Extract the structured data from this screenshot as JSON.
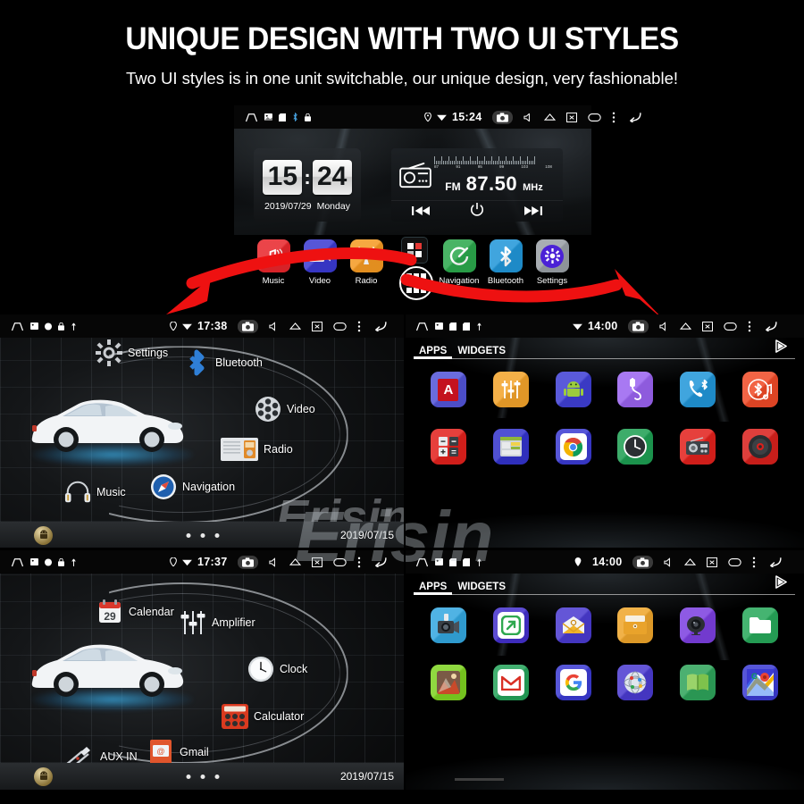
{
  "header": {
    "title": "UNIQUE DESIGN WITH TWO UI STYLES",
    "subtitle": "Two UI styles is in one unit switchable, our unique design, very fashionable!"
  },
  "brand": {
    "watermark": "Erisin",
    "accent": "#ff0000"
  },
  "statusbar_icons": {
    "home": "home-icon",
    "image": "image-icon",
    "sd": "sd-card-icon",
    "lock": "lock-icon",
    "usb": "usb-icon",
    "gps": "gps-icon",
    "wifi": "wifi-icon",
    "camera": "camera-icon",
    "mute": "volume-mute-icon",
    "eject": "eject-icon",
    "close": "close-window-icon",
    "recents": "recents-icon",
    "menu": "overflow-menu-icon",
    "back": "back-icon"
  },
  "home_screen": {
    "statusbar": {
      "time": "15:24"
    },
    "clock_widget": {
      "hours": "15",
      "colon": ":",
      "minutes": "24",
      "date": "2019/07/29",
      "weekday": "Monday"
    },
    "radio_widget": {
      "band": "FM",
      "frequency": "87.50",
      "unit": "MHz",
      "scale_labels": [
        "87",
        "91",
        "95",
        "99",
        "103",
        "108"
      ],
      "prev_label": "prev-track-icon",
      "power_label": "power-icon",
      "next_label": "next-track-icon"
    },
    "dock": [
      {
        "label": "Music",
        "icon": "music-icon",
        "color": "#e8262b"
      },
      {
        "label": "Video",
        "icon": "video-icon",
        "color": "#3b3ad2"
      },
      {
        "label": "Radio",
        "icon": "radio-tower-icon",
        "color": "#f59a22"
      },
      {
        "label": "Navigation",
        "icon": "navigation-icon",
        "color": "#2ba84c"
      },
      {
        "label": "Bluetooth",
        "icon": "bluetooth-icon",
        "color": "#2196d8"
      },
      {
        "label": "Settings",
        "icon": "settings-gear-icon",
        "color": "#9aa0a6"
      }
    ],
    "grid_buttons": {
      "small": "apps-grid-small-icon",
      "large": "apps-grid-large-icon"
    }
  },
  "carousel_top": {
    "statusbar": {
      "time": "17:38"
    },
    "items": [
      {
        "label": "Settings",
        "icon": "settings-gear-icon"
      },
      {
        "label": "Bluetooth",
        "icon": "bluetooth-icon"
      },
      {
        "label": "Video",
        "icon": "film-reel-icon"
      },
      {
        "label": "Radio",
        "icon": "radio-set-icon"
      },
      {
        "label": "Navigation",
        "icon": "compass-icon"
      },
      {
        "label": "Music",
        "icon": "headphones-icon"
      }
    ],
    "bottom_bar": {
      "date": "2019/07/15",
      "page_dots": 3,
      "active_dot": 0,
      "android_icon": "android-icon"
    }
  },
  "carousel_bottom": {
    "statusbar": {
      "time": "17:37"
    },
    "items": [
      {
        "label": "Calendar",
        "icon": "calendar-icon"
      },
      {
        "label": "Amplifier",
        "icon": "equalizer-icon"
      },
      {
        "label": "Clock",
        "icon": "analog-clock-icon"
      },
      {
        "label": "Calculator",
        "icon": "calculator-icon"
      },
      {
        "label": "Gmail",
        "icon": "gmail-icon"
      },
      {
        "label": "AUX IN",
        "icon": "aux-plug-icon"
      }
    ],
    "bottom_bar": {
      "date": "2019/07/15",
      "page_dots": 3,
      "active_dot": 0,
      "android_icon": "android-icon"
    }
  },
  "apps_drawer_top": {
    "statusbar": {
      "time": "14:00"
    },
    "tabs": [
      {
        "label": "APPS",
        "active": true
      },
      {
        "label": "WIDGETS",
        "active": false
      }
    ],
    "play_store_icon": "play-store-icon",
    "apps": [
      {
        "label": "Adobe Acrob",
        "icon": "adobe-acrobat-icon",
        "color": "#5254d8"
      },
      {
        "label": "Amplifier",
        "icon": "equalizer-icon",
        "color": "#f3a32a"
      },
      {
        "label": "APK Installer",
        "icon": "apk-installer-icon",
        "color": "#3f3fd4"
      },
      {
        "label": "AUX IN",
        "icon": "aux-plug-icon",
        "color": "#9a63f0"
      },
      {
        "label": "Bluetooth",
        "icon": "bluetooth-phone-icon",
        "color": "#2196d8"
      },
      {
        "label": "BT Music",
        "icon": "bt-music-icon",
        "color": "#f04a27"
      },
      {
        "label": "Calculator",
        "icon": "calculator-icon",
        "color": "#e2211c"
      },
      {
        "label": "Calendar",
        "icon": "calendar-icon",
        "color": "#3333cc"
      },
      {
        "label": "Chrome",
        "icon": "chrome-icon",
        "color": "#3b3ad2"
      },
      {
        "label": "Clock",
        "icon": "clock-icon",
        "color": "#1d9e52"
      },
      {
        "label": "DAB+",
        "icon": "dab-radio-icon",
        "color": "#e2211c"
      },
      {
        "label": "DVD",
        "icon": "dvd-disc-icon",
        "color": "#d8201c"
      }
    ]
  },
  "apps_drawer_bottom": {
    "statusbar": {
      "time": "14:00"
    },
    "tabs": [
      {
        "label": "APPS",
        "active": true
      },
      {
        "label": "WIDGETS",
        "active": false
      }
    ],
    "play_store_icon": "play-store-icon",
    "apps": [
      {
        "label": "DVR",
        "icon": "dvr-camera-icon",
        "color": "#33a7e0"
      },
      {
        "label": "EasyConnec",
        "icon": "easyconnect-icon",
        "color": "#4330cc"
      },
      {
        "label": "Email",
        "icon": "email-icon",
        "color": "#4a3ad0"
      },
      {
        "label": "ES File Explo",
        "icon": "es-file-explorer-icon",
        "color": "#efa52a"
      },
      {
        "label": "F-Camera",
        "icon": "front-camera-icon",
        "color": "#7c3fe0"
      },
      {
        "label": "Files",
        "icon": "files-folder-icon",
        "color": "#27a85a"
      },
      {
        "label": "Gallery",
        "icon": "gallery-icon",
        "color": "#7ed321"
      },
      {
        "label": "Gmail",
        "icon": "gmail-icon",
        "color": "#24a35a"
      },
      {
        "label": "Google",
        "icon": "google-icon",
        "color": "#3b3ad2"
      },
      {
        "label": "GPS Test",
        "icon": "gps-test-icon",
        "color": "#4a3ad0"
      },
      {
        "label": "Instructions",
        "icon": "instructions-book-icon",
        "color": "#2ea35a"
      },
      {
        "label": "Maps",
        "icon": "maps-icon",
        "color": "#3b3ad2"
      }
    ]
  }
}
